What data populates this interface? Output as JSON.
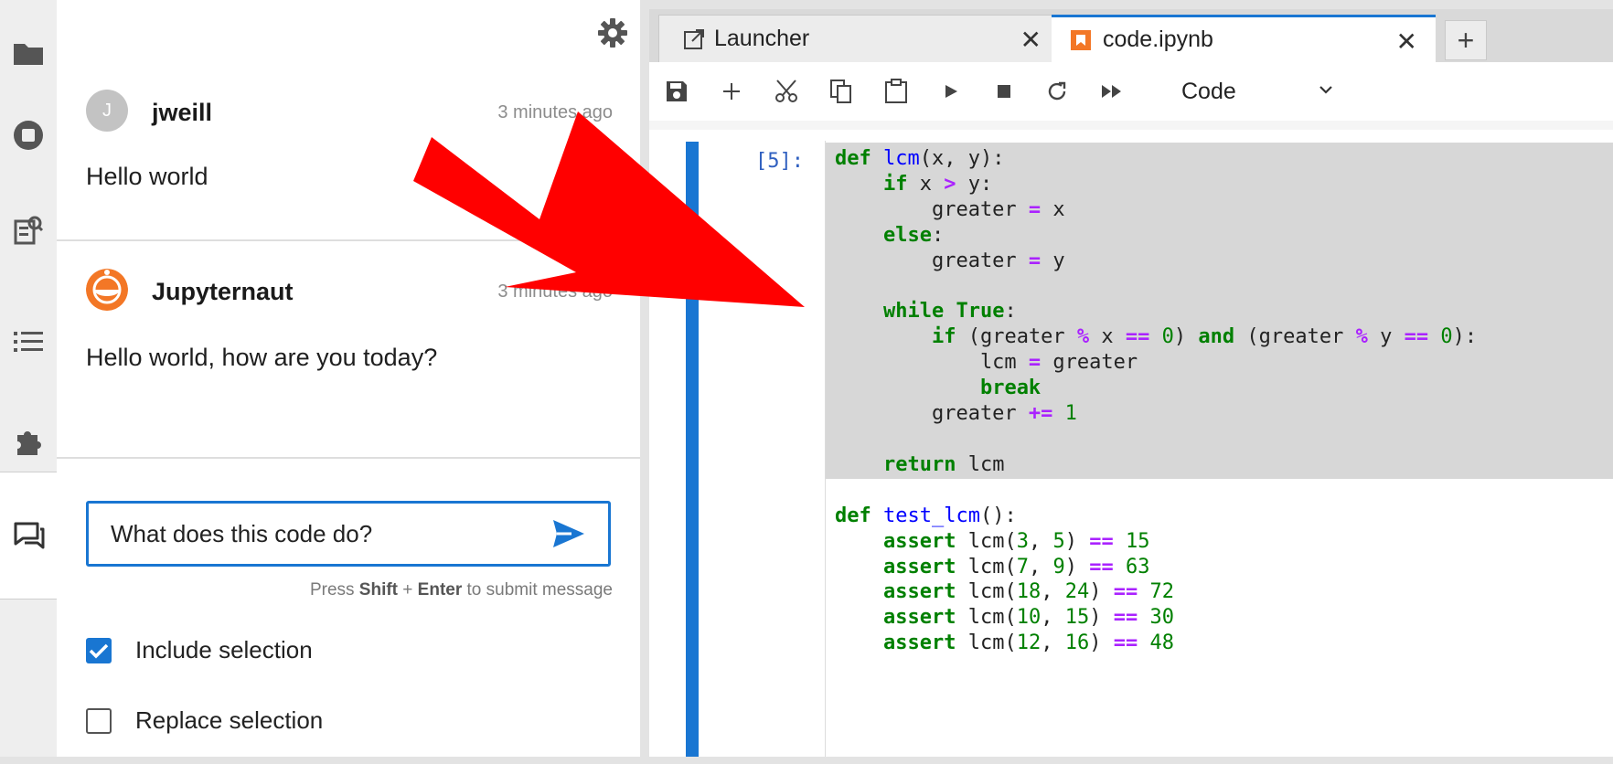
{
  "activity_bar": {
    "icons": [
      "folder-icon",
      "running-icon",
      "property-inspector-icon",
      "toc-icon",
      "extension-icon",
      "chat-icon"
    ]
  },
  "chat": {
    "messages": [
      {
        "initial": "J",
        "sender": "jweill",
        "time": "3 minutes ago",
        "body": "Hello world"
      },
      {
        "sender": "Jupyternaut",
        "time": "3 minutes ago",
        "body": "Hello world, how are you today?"
      }
    ],
    "input": {
      "value": "What does this code do?",
      "placeholder": ""
    },
    "hint": {
      "prefix": "Press ",
      "key1": "Shift",
      "plus": " + ",
      "key2": "Enter",
      "suffix": " to submit message"
    },
    "options": [
      {
        "label": "Include selection",
        "checked": true
      },
      {
        "label": "Replace selection",
        "checked": false
      }
    ]
  },
  "tabs": [
    {
      "label": "Launcher",
      "active": false
    },
    {
      "label": "code.ipynb",
      "active": true
    }
  ],
  "toolbar": {
    "cell_type": "Code"
  },
  "cell": {
    "prompt": "[5]:"
  },
  "colors": {
    "accent": "#1976d2",
    "arrow": "#ff0000",
    "jupyternaut": "#f37726"
  }
}
